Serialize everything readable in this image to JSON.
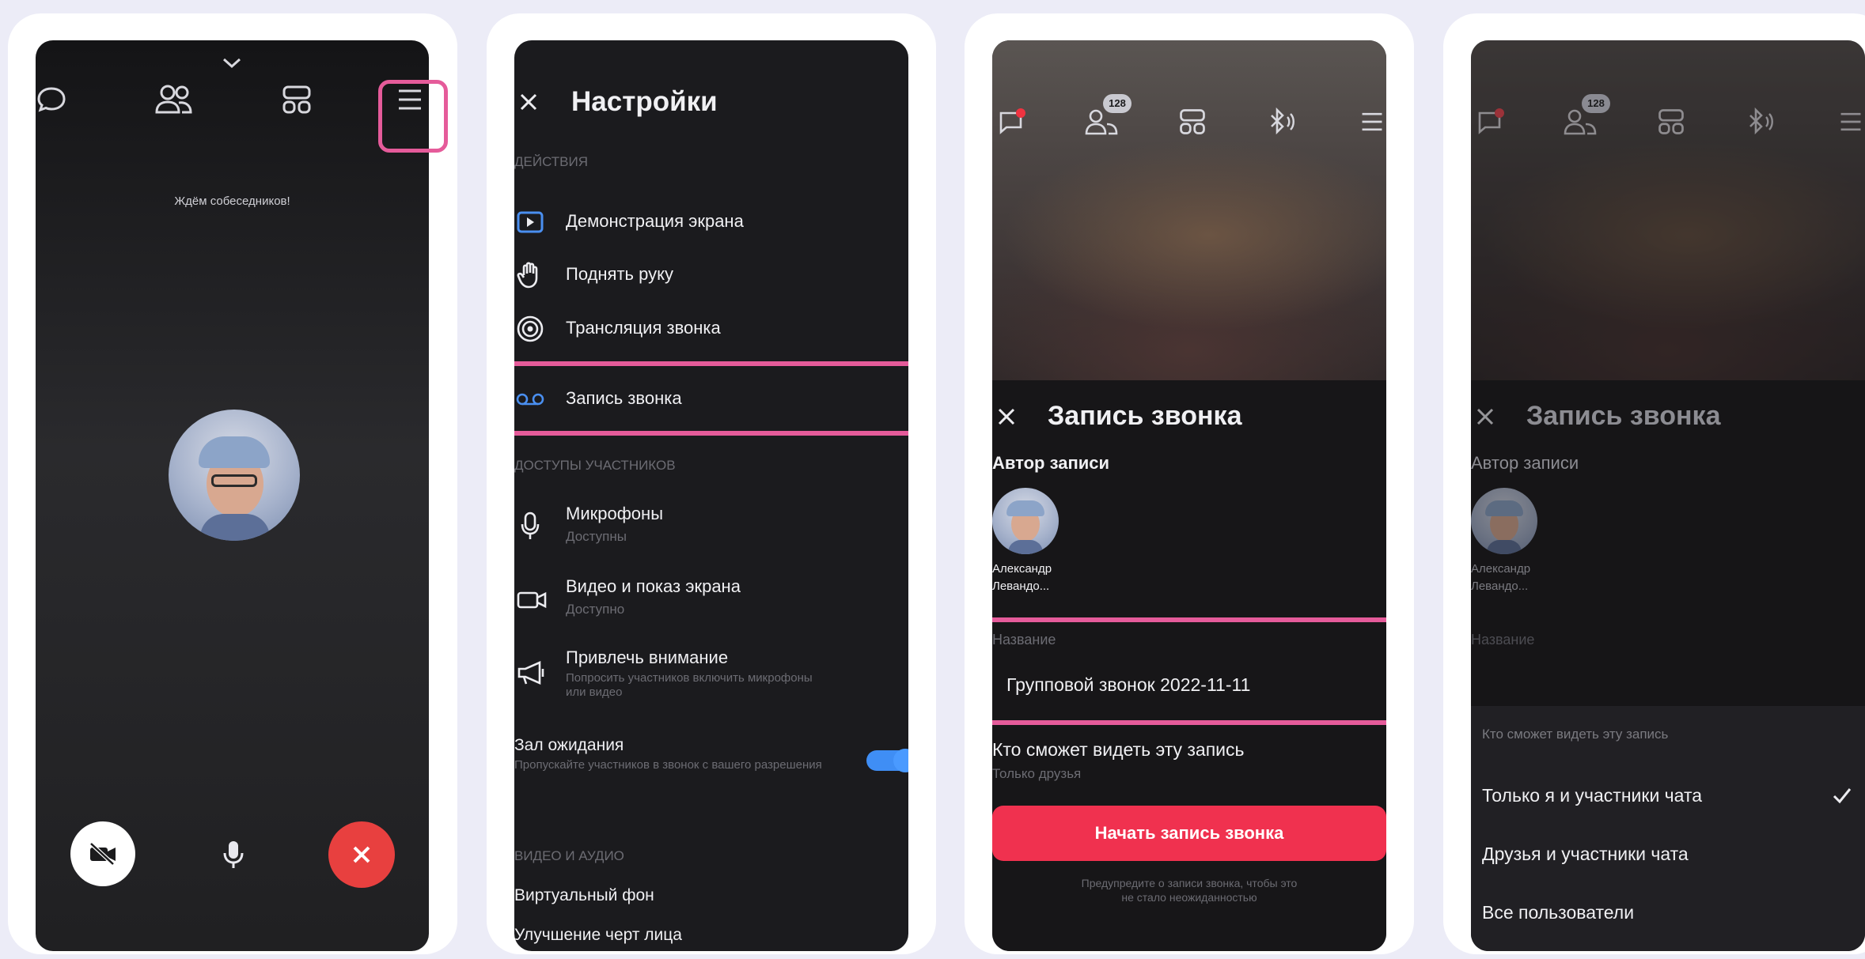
{
  "screen1": {
    "status_text": "Ждём собеседников!"
  },
  "screen2": {
    "title": "Настройки",
    "section_actions": "ДЕЙСТВИЯ",
    "items": [
      {
        "label": "Демонстрация экрана",
        "icon": "screen-share-icon"
      },
      {
        "label": "Поднять руку",
        "icon": "raise-hand-icon"
      },
      {
        "label": "Трансляция звонка",
        "icon": "broadcast-icon"
      },
      {
        "label": "Запись звонка",
        "icon": "record-icon"
      }
    ],
    "section_access": "ДОСТУПЫ УЧАСТНИКОВ",
    "access": [
      {
        "label": "Микрофоны",
        "sub": "Доступны",
        "icon": "microphone-icon"
      },
      {
        "label": "Видео и показ экрана",
        "sub": "Доступно",
        "icon": "camera-icon"
      },
      {
        "label": "Привлечь внимание",
        "sub": "Попросить участников включить микрофоны или видео",
        "icon": "megaphone-icon"
      }
    ],
    "waiting_room": {
      "label": "Зал ожидания",
      "sub": "Пропускайте участников в звонок с вашего разрешения",
      "enabled": true
    },
    "section_video": "ВИДЕО И АУДИО",
    "video_items": [
      "Виртуальный фон",
      "Улучшение черт лица"
    ]
  },
  "screen3": {
    "badge": "128",
    "title": "Запись звонка",
    "author_label": "Автор записи",
    "author_name_1": "Александр",
    "author_name_2": "Левандо...",
    "name_label": "Название",
    "name_value": "Групповой звонок 2022-11-11",
    "visibility_label": "Кто сможет видеть эту запись",
    "visibility_value": "Только друзья",
    "start_button": "Начать запись звонка",
    "warning_1": "Предупредите о записи звонка, чтобы это",
    "warning_2": "не стало неожиданностью"
  },
  "screen4": {
    "badge": "128",
    "title": "Запись звонка",
    "author_label": "Автор записи",
    "author_name_1": "Александр",
    "author_name_2": "Левандо...",
    "name_label": "Название",
    "dropdown_label": "Кто сможет видеть эту запись",
    "options": [
      "Только я и участники чата",
      "Друзья и участники чата",
      "Все пользователи"
    ],
    "selected_index": 0
  },
  "colors": {
    "highlight": "#e55b9a",
    "primary_button": "#f0314f",
    "end_call": "#e8403f",
    "toggle": "#3f8ef5"
  }
}
